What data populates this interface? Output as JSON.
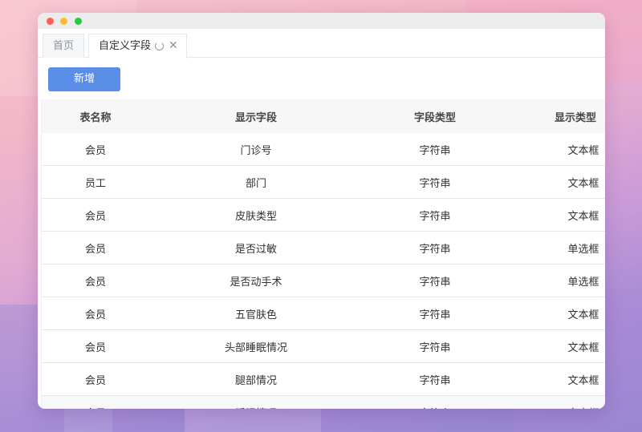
{
  "tabs": [
    {
      "label": "首页",
      "active": false
    },
    {
      "label": "自定义字段",
      "active": true
    }
  ],
  "toolbar": {
    "add_label": "新增"
  },
  "table": {
    "columns": [
      "表名称",
      "显示字段",
      "字段类型",
      "显示类型"
    ],
    "rows": [
      [
        "会员",
        "门诊号",
        "字符串",
        "文本框"
      ],
      [
        "员工",
        "部门",
        "字符串",
        "文本框"
      ],
      [
        "会员",
        "皮肤类型",
        "字符串",
        "文本框"
      ],
      [
        "会员",
        "是否过敏",
        "字符串",
        "单选框"
      ],
      [
        "会员",
        "是否动手术",
        "字符串",
        "单选框"
      ],
      [
        "会员",
        "五官肤色",
        "字符串",
        "文本框"
      ],
      [
        "会员",
        "头部睡眠情况",
        "字符串",
        "文本框"
      ],
      [
        "会员",
        "腿部情况",
        "字符串",
        "文本框"
      ],
      [
        "会员",
        "睡眠情况",
        "字符串",
        "文本框"
      ]
    ]
  },
  "colors": {
    "accent": "#5a8de6",
    "window_red": "#ff5f57",
    "window_yellow": "#febc2e",
    "window_green": "#28c840"
  }
}
